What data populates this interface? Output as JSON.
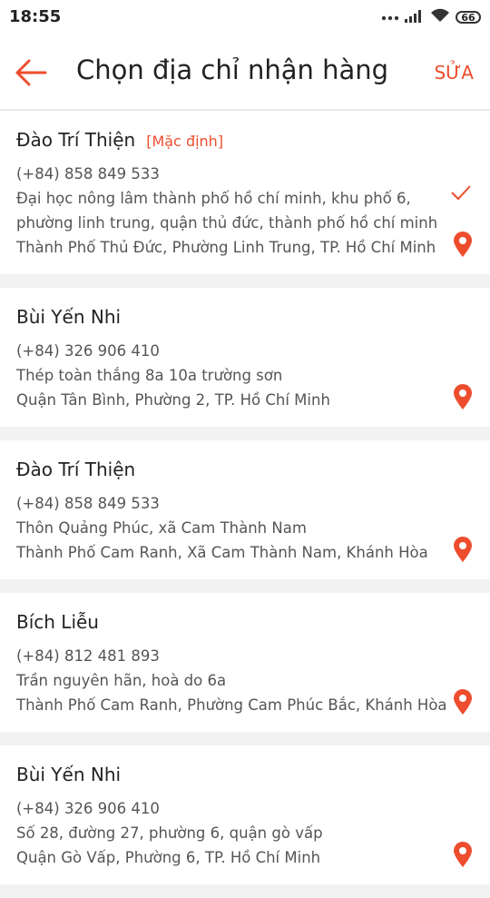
{
  "status": {
    "time": "18:55",
    "battery": "66"
  },
  "header": {
    "title": "Chọn địa chỉ nhận hàng",
    "edit_label": "SỬA"
  },
  "colors": {
    "accent": "#ee4d2d",
    "background": "#f2f2f2"
  },
  "icons": {
    "back": "arrow-left-icon",
    "selected": "checkmark-icon",
    "location": "map-pin-icon"
  },
  "addresses": [
    {
      "name": "Đào Trí Thiện",
      "badge": "[Mặc định]",
      "phone": "(+84) 858 849 533",
      "lines": [
        "Đại học nông lâm thành phố hồ chí minh, khu phố 6,",
        "phường linh trung, quận thủ đức, thành phố hồ chí minh"
      ],
      "region": "Thành Phố Thủ Đức, Phường Linh Trung, TP. Hồ Chí Minh",
      "selected": true
    },
    {
      "name": "Bùi Yến Nhi",
      "phone": "(+84) 326 906 410",
      "lines": [
        "Thép toàn thắng 8a 10a trường sơn"
      ],
      "region": "Quận Tân Bình, Phường 2, TP. Hồ Chí Minh",
      "selected": false
    },
    {
      "name": "Đào Trí Thiện",
      "phone": "(+84) 858 849 533",
      "lines": [
        "Thôn Quảng Phúc, xã Cam Thành Nam"
      ],
      "region": "Thành Phố Cam Ranh, Xã Cam Thành Nam, Khánh Hòa",
      "selected": false
    },
    {
      "name": "Bích Liễu",
      "phone": "(+84) 812 481 893",
      "lines": [
        "Trần nguyên hãn, hoà do 6a"
      ],
      "region": "Thành Phố Cam Ranh, Phường Cam Phúc Bắc, Khánh Hòa",
      "selected": false
    },
    {
      "name": "Bùi Yến Nhi",
      "phone": "(+84) 326 906 410",
      "lines": [
        "Số 28, đường 27, phường 6, quận gò vấp"
      ],
      "region": "Quận Gò Vấp, Phường 6, TP. Hồ Chí Minh",
      "selected": false
    }
  ]
}
